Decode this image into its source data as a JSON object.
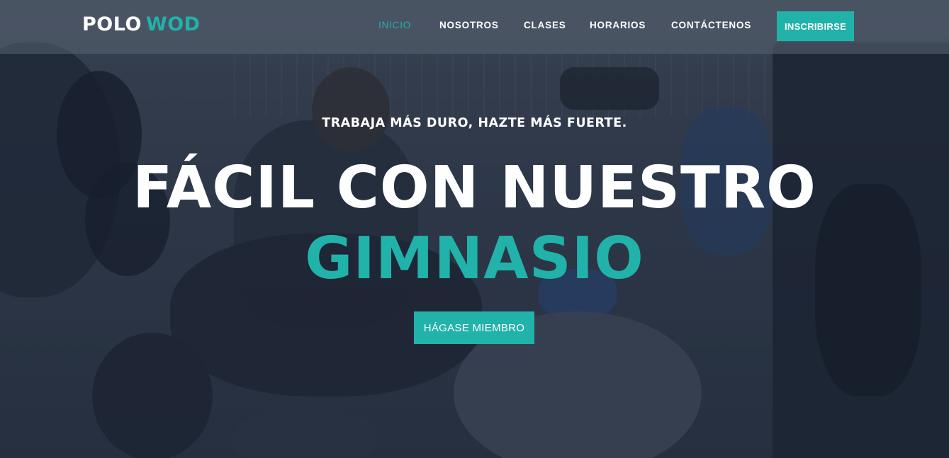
{
  "brand": {
    "name_part1": "POLO",
    "name_part2": "WOD",
    "accent_color": "#21b2aa"
  },
  "nav": {
    "items": [
      {
        "label": "INICIO",
        "active": true
      },
      {
        "label": "NOSOTROS",
        "active": false
      },
      {
        "label": "CLASES",
        "active": false
      },
      {
        "label": "HORARIOS",
        "active": false
      },
      {
        "label": "CONTÁCTENOS",
        "active": false
      }
    ],
    "cta_label": "INSCRIBIRSE"
  },
  "hero": {
    "tagline": "TRABAJA MÁS DURO, HAZTE MÁS FUERTE.",
    "headline": "FÁCIL CON NUESTRO",
    "headline_accent": "GIMNASIO",
    "cta_label": "HÁGASE MIEMBRO"
  }
}
